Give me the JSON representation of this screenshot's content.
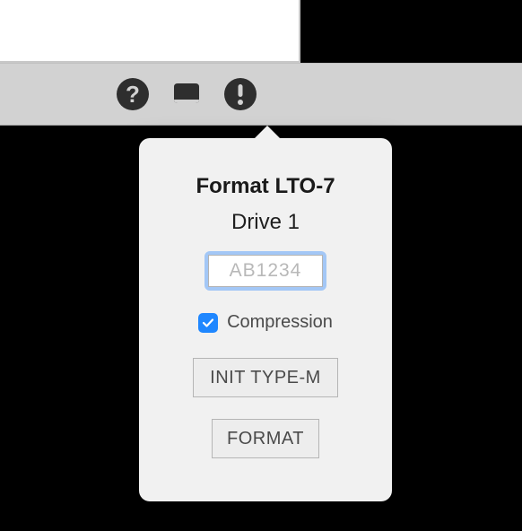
{
  "toolbar": {
    "help_icon": "help-icon",
    "tape_icon": "tape-icon",
    "alert_icon": "alert-icon"
  },
  "popover": {
    "title": "Format LTO-7",
    "subtitle": "Drive 1",
    "tape_field": {
      "value": "",
      "placeholder": "AB1234"
    },
    "compression": {
      "checked": true,
      "label": "Compression"
    },
    "init_button_label": "INIT TYPE-M",
    "format_button_label": "FORMAT"
  }
}
